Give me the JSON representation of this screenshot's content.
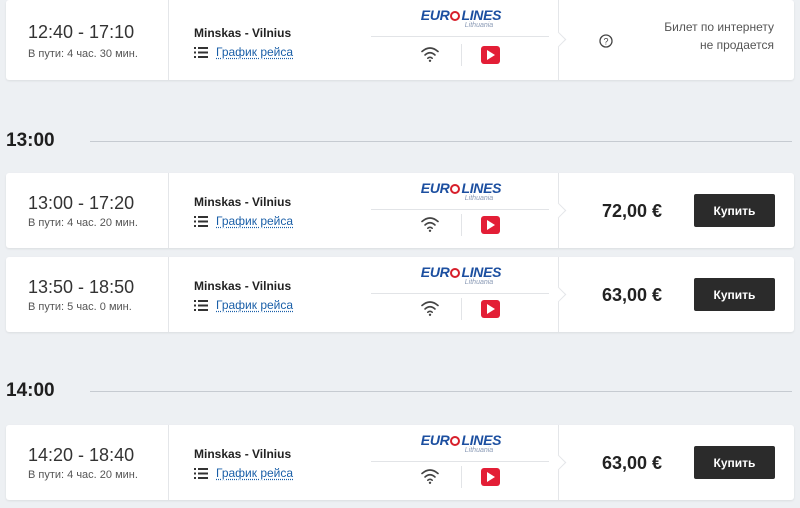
{
  "trips": [
    {
      "depart": "12:40",
      "arrive": "17:10",
      "duration": "В пути: 4 час. 30 мин.",
      "route": "Minskas - Vilnius",
      "schedule_link": "График рейса",
      "carrier_logo": "EUROLINES",
      "carrier_sub": "Lithuania",
      "amenities": [
        "wifi-icon",
        "video-icon"
      ],
      "price": "",
      "buy_label": "",
      "no_online_sale": "Билет по интернету не продается"
    },
    {
      "depart": "13:00",
      "arrive": "17:20",
      "duration": "В пути: 4 час. 20 мин.",
      "route": "Minskas - Vilnius",
      "schedule_link": "График рейса",
      "carrier_logo": "EUROLINES",
      "carrier_sub": "Lithuania",
      "amenities": [
        "wifi-icon",
        "video-icon"
      ],
      "price": "72,00 €",
      "buy_label": "Купить"
    },
    {
      "depart": "13:50",
      "arrive": "18:50",
      "duration": "В пути: 5 час. 0 мин.",
      "route": "Minskas - Vilnius",
      "schedule_link": "График рейса",
      "carrier_logo": "EUROLINES",
      "carrier_sub": "Lithuania",
      "amenities": [
        "wifi-icon",
        "video-icon"
      ],
      "price": "63,00 €",
      "buy_label": "Купить"
    },
    {
      "depart": "14:20",
      "arrive": "18:40",
      "duration": "В пути: 4 час. 20 мин.",
      "route": "Minskas - Vilnius",
      "schedule_link": "График рейса",
      "carrier_logo": "EUROLINES",
      "carrier_sub": "Lithuania",
      "amenities": [
        "wifi-icon",
        "video-icon"
      ],
      "price": "63,00 €",
      "buy_label": "Купить"
    }
  ],
  "groups": [
    {
      "label": "13:00"
    },
    {
      "label": "14:00"
    }
  ],
  "time_separator": " - ",
  "colors": {
    "page_bg": "#edf0f3",
    "buy_button": "#2b2b2b",
    "link": "#1a5fa8",
    "video_badge": "#e31e36",
    "logo_blue": "#1c4fa0",
    "logo_red": "#d71f2b"
  }
}
